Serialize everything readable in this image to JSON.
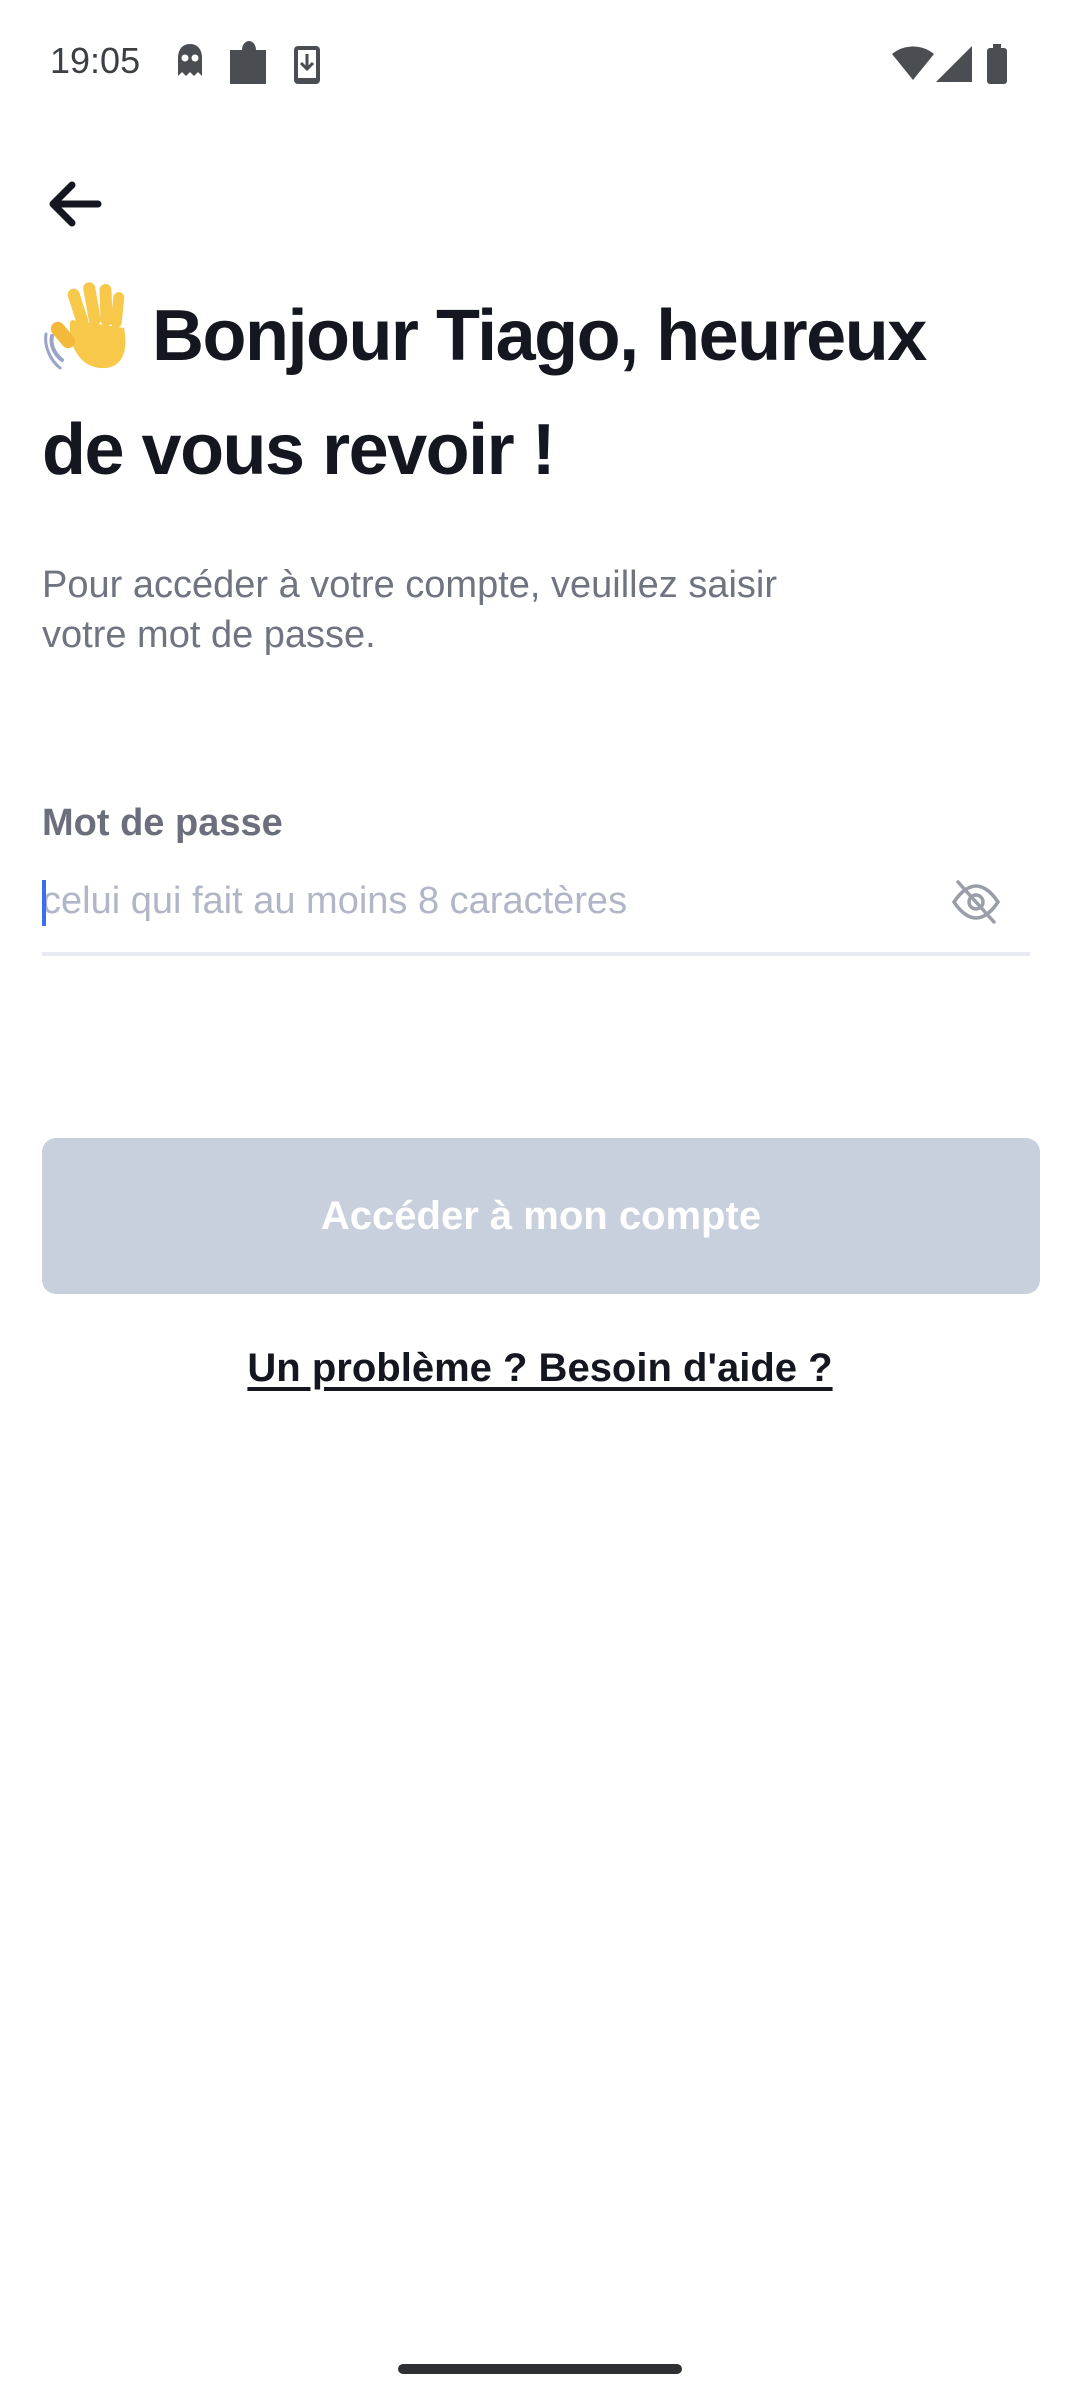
{
  "status_bar": {
    "time": "19:05",
    "left_icons": [
      "incognito-icon",
      "puzzle-icon",
      "download-icon"
    ],
    "right_icons": [
      "wifi-icon",
      "signal-icon",
      "battery-icon"
    ]
  },
  "header": {
    "back_icon": "arrow-left-icon"
  },
  "greeting": {
    "emoji": "waving-hand-icon",
    "line1": "Bonjour Tiago, heureux",
    "line2": "de vous revoir !"
  },
  "subtitle": {
    "line1": "Pour accéder à votre compte, veuillez saisir",
    "line2": "votre mot de passe."
  },
  "password_field": {
    "label": "Mot de passe",
    "value": "",
    "placeholder": "celui qui fait au moins 8 caractères",
    "toggle_icon": "eye-off-icon"
  },
  "submit": {
    "label": "Accéder à mon compte",
    "disabled": true
  },
  "help": {
    "label": "Un problème ? Besoin d'aide ?"
  },
  "colors": {
    "text_primary": "#14171f",
    "text_secondary": "#6f7480",
    "placeholder": "#b1b6c6",
    "button_disabled": "#c8cfdd",
    "caret": "#3b6cf1",
    "emoji": "#f7c84a"
  }
}
